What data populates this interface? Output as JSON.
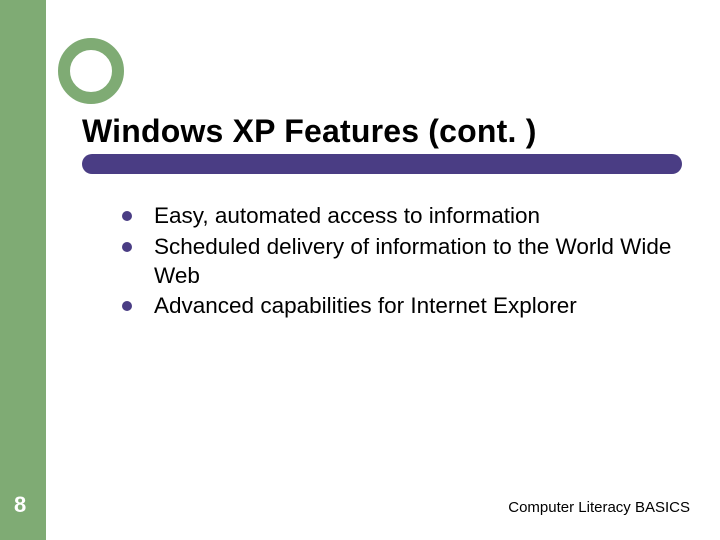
{
  "title": "Windows XP Features (cont. )",
  "bullets": [
    "Easy, automated access to information",
    "Scheduled delivery of information to the World Wide Web",
    "Advanced capabilities for Internet Explorer"
  ],
  "page_number": "8",
  "footer": "Computer Literacy BASICS"
}
